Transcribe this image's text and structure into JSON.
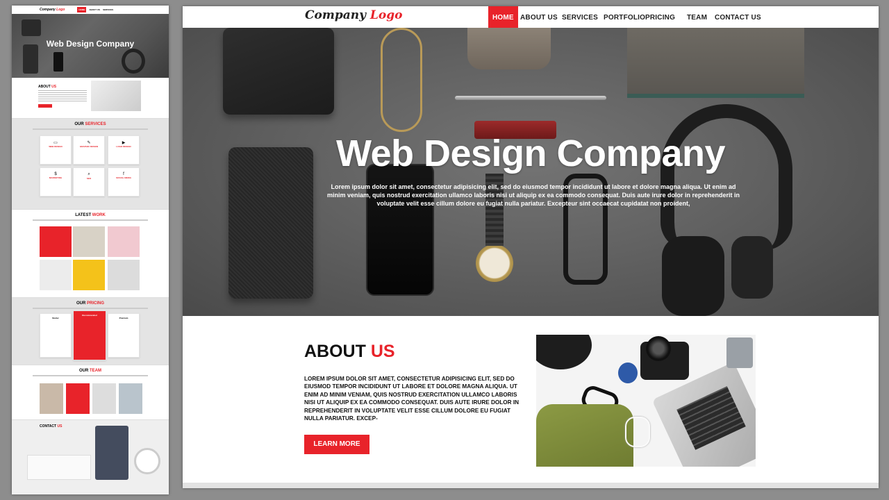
{
  "nav": {
    "logo_main": "Company",
    "logo_accent": "Logo",
    "items": [
      "HOME",
      "ABOUT US",
      "SERVICES",
      "PORTFOLIO",
      "PRICING",
      "TEAM",
      "CONTACT US"
    ],
    "active": "HOME"
  },
  "hero": {
    "title": "Web Design Company",
    "text": "Lorem ipsum dolor sit amet, consectetur adipisicing elit, sed do eiusmod tempor incididunt ut labore et dolore magna aliqua. Ut enim ad minim veniam, quis nostrud exercitation ullamco laboris nisi ut aliquip ex ea commodo consequat. Duis aute irure dolor in reprehenderit in voluptate velit esse cillum dolore eu fugiat nulla pariatur. Excepteur sint occaecat cupidatat non proident,"
  },
  "about": {
    "title_main": "ABOUT",
    "title_accent": "US",
    "text": "LOREM IPSUM DOLOR SIT AMET, CONSECTETUR ADIPISICING ELIT, SED DO EIUSMOD TEMPOR INCIDIDUNT UT LABORE ET DOLORE MAGNA ALIQUA. UT ENIM AD MINIM VENIAM, QUIS NOSTRUD EXERCITATION ULLAMCO LABORIS NISI UT ALIQUIP EX EA COMMODO CONSEQUAT. DUIS AUTE IRURE DOLOR IN REPREHENDERIT IN VOLUPTATE VELIT ESSE CILLUM DOLORE EU FUGIAT NULLA PARIATUR. EXCEP-",
    "button": "LEARN MORE"
  },
  "preview": {
    "hero_title": "Web Design Company",
    "about_main": "ABOUT",
    "about_accent": "US",
    "services_main": "OUR",
    "services_accent": "SERVICES",
    "services": [
      "WEB DESIGN",
      "GRAPHIC DESIGN",
      "LOGO DESIGN",
      "MARKETING",
      "SEO",
      "SOCIAL MEDIA"
    ],
    "service_icons": [
      "monitor-icon",
      "pencil-icon",
      "play-icon",
      "dollar-icon",
      "search-icon",
      "facebook-icon"
    ],
    "service_glyphs": [
      "▭",
      "✎",
      "▶",
      "$",
      "⌕",
      "f"
    ],
    "work_main": "LATEST",
    "work_accent": "WORK",
    "pricing_main": "OUR",
    "pricing_accent": "PRICING",
    "plans": [
      "Starter",
      "Recommended",
      "Premium"
    ],
    "team_main": "OUR",
    "team_accent": "TEAM",
    "contact_main": "CONTACT",
    "contact_accent": "US"
  },
  "colors": {
    "accent": "#e8232a",
    "background": "#8d8d8d"
  }
}
